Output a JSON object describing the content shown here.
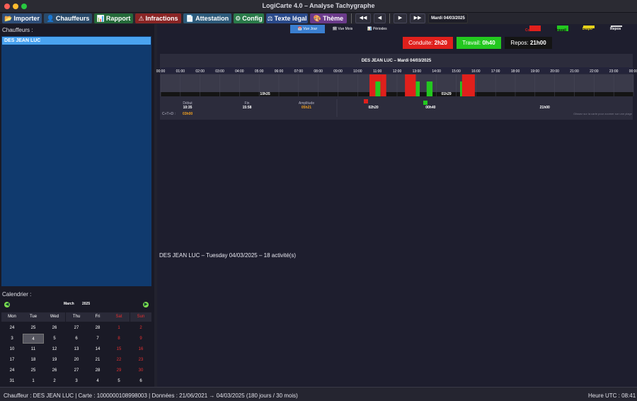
{
  "window": {
    "title": "LogiCarte 4.0  –  Analyse Tachygraphe"
  },
  "colors": {
    "conduite": "#e0201c",
    "travail": "#23c81f",
    "dispo": "#e6d21a",
    "repos": "#111111",
    "accent": "#4aa3f0"
  },
  "toolbar": {
    "buttons": [
      {
        "label": "Importer",
        "icon": "folder-icon",
        "glyph": "📂"
      },
      {
        "label": "Chauffeurs",
        "icon": "person-icon",
        "glyph": "👤"
      },
      {
        "label": "Rapport",
        "icon": "report-icon",
        "glyph": "📊"
      },
      {
        "label": "Infractions",
        "icon": "warning-icon",
        "glyph": "⚠"
      },
      {
        "label": "Attestation",
        "icon": "document-icon",
        "glyph": "📄"
      },
      {
        "label": "Config",
        "icon": "gear-icon",
        "glyph": "⚙"
      },
      {
        "label": "Texte légal",
        "icon": "law-icon",
        "glyph": "⚖"
      },
      {
        "label": "Thème",
        "icon": "palette-icon",
        "glyph": "🎨"
      }
    ],
    "nav": {
      "first": "◀◀",
      "prev": "◀",
      "next": "▶",
      "last": "▶▶",
      "date": "Mardi 04/03/2025"
    }
  },
  "sidebar": {
    "drivers_label": "Chauffeurs :",
    "drivers": [
      "DES JEAN LUC"
    ],
    "calendar_label": "Calendrier :",
    "calendar": {
      "month": "March",
      "year": "2025",
      "prev_glyph": "◀",
      "next_glyph": "▶",
      "days": [
        "Mon",
        "Tue",
        "Wed",
        "Thu",
        "Fri",
        "Sat",
        "Sun"
      ],
      "weeks": [
        [
          "24",
          "25",
          "26",
          "27",
          "28",
          "1",
          "2"
        ],
        [
          "3",
          "4",
          "5",
          "6",
          "7",
          "8",
          "9"
        ],
        [
          "10",
          "11",
          "12",
          "13",
          "14",
          "15",
          "16"
        ],
        [
          "17",
          "18",
          "19",
          "20",
          "21",
          "22",
          "23"
        ],
        [
          "24",
          "25",
          "26",
          "27",
          "28",
          "29",
          "30"
        ],
        [
          "31",
          "1",
          "2",
          "3",
          "4",
          "5",
          "6"
        ]
      ],
      "selected": "4"
    }
  },
  "main": {
    "tabs": [
      {
        "label": "Vue Jour",
        "glyph": "📅"
      },
      {
        "label": "Vue Mois",
        "glyph": "🗓"
      },
      {
        "label": "Périodes",
        "glyph": "📊"
      }
    ],
    "legend": [
      {
        "label": "Conduite",
        "color": "#e0201c"
      },
      {
        "label": "Travail",
        "color": "#23c81f"
      },
      {
        "label": "Dispo",
        "color": "#e6d21a"
      },
      {
        "label": "Repos",
        "color": "#111111"
      }
    ],
    "summary": [
      {
        "label": "Conduite:",
        "value": "2h20"
      },
      {
        "label": "Travail:",
        "value": "0h40"
      },
      {
        "label": "Repos:",
        "value": "21h00"
      }
    ],
    "footer_text": "DES JEAN LUC  –  Tuesday 04/03/2025  –  18 activité(s)"
  },
  "chart_data": {
    "type": "timeline",
    "title": "DES JEAN LUC  –  Mardi  04/03/2025",
    "hours": [
      "00:00",
      "01:00",
      "02:00",
      "03:00",
      "04:00",
      "05:00",
      "06:00",
      "07:00",
      "08:00",
      "09:00",
      "10:00",
      "11:00",
      "12:00",
      "13:00",
      "14:00",
      "15:00",
      "16:00",
      "17:00",
      "18:00",
      "19:00",
      "20:00",
      "21:00",
      "22:00",
      "23:00",
      "00:00"
    ],
    "segments": [
      {
        "type": "conduite",
        "start": 10.6,
        "end": 11.2
      },
      {
        "type": "travail",
        "start": 10.9,
        "end": 11.15
      },
      {
        "type": "conduite",
        "start": 11.2,
        "end": 11.45
      },
      {
        "type": "conduite",
        "start": 12.4,
        "end": 12.95
      },
      {
        "type": "travail",
        "start": 12.95,
        "end": 13.15
      },
      {
        "type": "travail",
        "start": 13.5,
        "end": 13.8
      },
      {
        "type": "travail",
        "start": 15.2,
        "end": 15.3
      },
      {
        "type": "conduite",
        "start": 15.3,
        "end": 15.95
      }
    ],
    "rest_labels": [
      {
        "text": "10h35",
        "at": 5.3
      },
      {
        "text": "01h29",
        "at": 14.5
      }
    ],
    "stats": [
      {
        "label": "Début",
        "value": "10:35",
        "color": "#ffffff"
      },
      {
        "label": "Fin",
        "value": "15:58",
        "color": "#ffffff"
      },
      {
        "label": "Amplitude",
        "value": "05h21",
        "color": "#f0a020"
      }
    ],
    "ct_label": "C+T+D :",
    "ct_value": "03h00",
    "bottom_labels": [
      {
        "text": "02h20",
        "at": 10.8
      },
      {
        "text": "00h40",
        "at": 13.7
      },
      {
        "text": "21h00",
        "at": 19.5
      }
    ],
    "hint": "Glissez sur la carte pour zoomer sur une plage"
  },
  "status": {
    "left": "Chauffeur : DES JEAN LUC  |  Carte : 1000000108998003  |  Données : 21/06/2021 → 04/03/2025  (180 jours / 30 mois)",
    "right": "Heure UTC : 08:41"
  }
}
